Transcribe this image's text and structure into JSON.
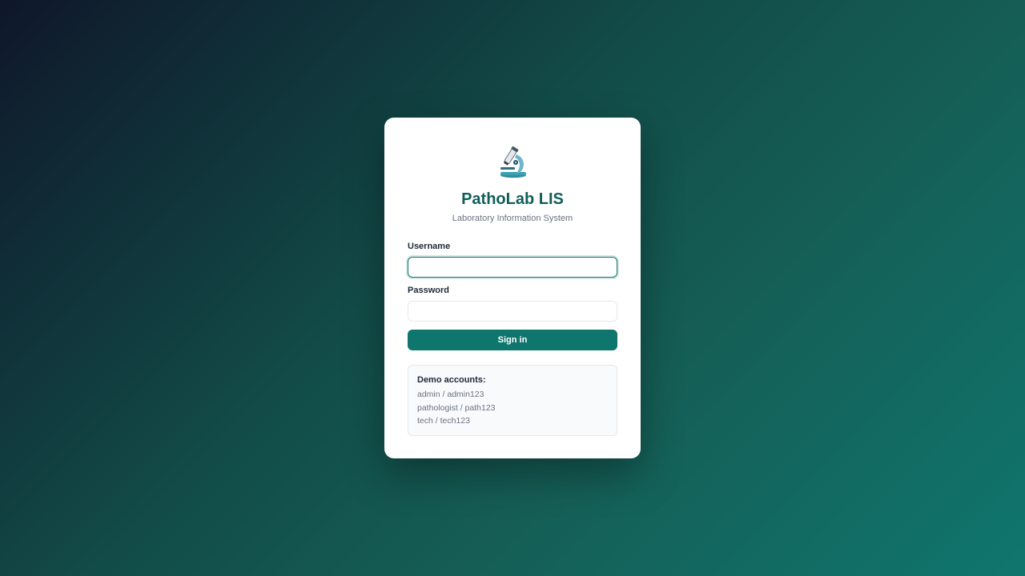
{
  "app": {
    "icon": "microscope-icon",
    "title": "PathoLab LIS",
    "subtitle": "Laboratory Information System"
  },
  "form": {
    "username_label": "Username",
    "username_value": "",
    "password_label": "Password",
    "password_value": "",
    "signin_label": "Sign in"
  },
  "demo": {
    "title": "Demo accounts:",
    "accounts": [
      "admin / admin123",
      "pathologist / path123",
      "tech / tech123"
    ]
  },
  "colors": {
    "accent": "#0f766e",
    "title": "#115e59"
  }
}
